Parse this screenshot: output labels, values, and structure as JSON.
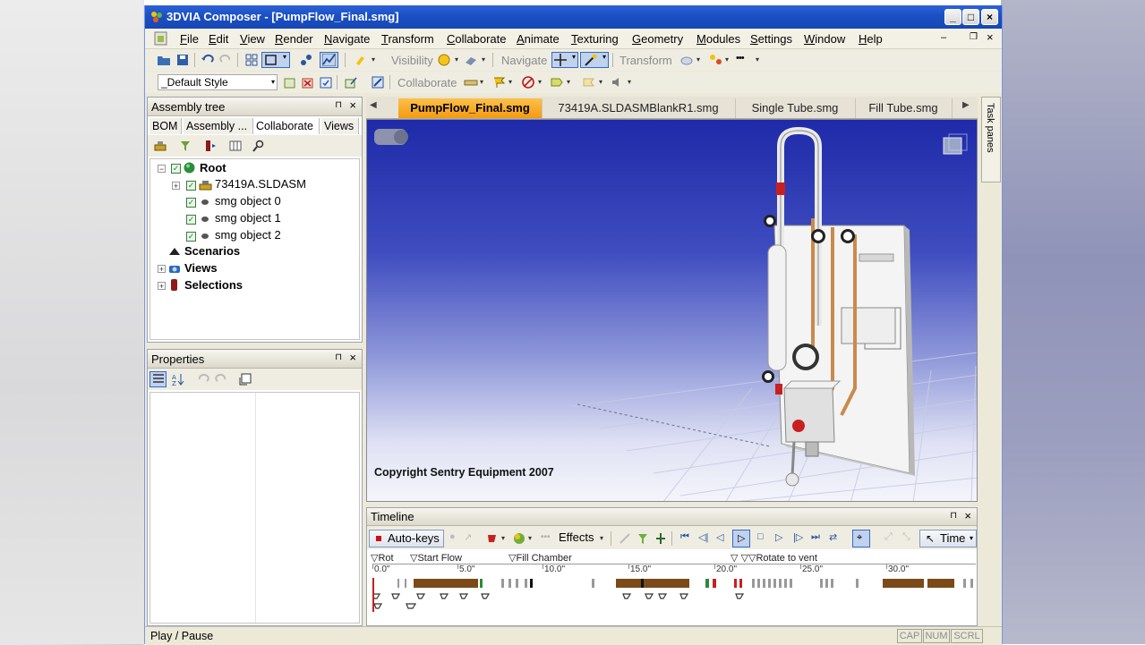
{
  "window": {
    "title": "3DVIA Composer - [PumpFlow_Final.smg]"
  },
  "menu": [
    "File",
    "Edit",
    "View",
    "Render",
    "Navigate",
    "Transform",
    "Collaborate",
    "Animate",
    "Texturing",
    "Geometry",
    "Modules",
    "Settings",
    "Window",
    "Help"
  ],
  "toolbar": {
    "visibility_label": "Visibility",
    "navigate_label": "Navigate",
    "transform_label": "Transform",
    "style_value": "_Default Style",
    "collaborate_label": "Collaborate"
  },
  "assembly_tree": {
    "title": "Assembly tree",
    "tabs": [
      "BOM",
      "Assembly ...",
      "Collaborate",
      "Views"
    ],
    "nodes": {
      "root": "Root",
      "asm": "73419A.SLDASM",
      "obj0": "smg object 0",
      "obj1": "smg object 1",
      "obj2": "smg object 2",
      "scenarios": "Scenarios",
      "views": "Views",
      "selections": "Selections"
    }
  },
  "properties": {
    "title": "Properties"
  },
  "document_tabs": [
    "PumpFlow_Final.smg",
    "73419A.SLDASMBlankR1.smg",
    "Single Tube.smg",
    "Fill Tube.smg"
  ],
  "viewport": {
    "copyright": "Copyright Sentry Equipment 2007"
  },
  "task_panes_label": "Task panes",
  "timeline": {
    "title": "Timeline",
    "autokeys_label": "Auto-keys",
    "effects_label": "Effects",
    "time_label": "Time",
    "markers": [
      "Rot",
      "Start Flow",
      "Fill Chamber",
      "Rotate to vent"
    ],
    "ticks": [
      "0.0\"",
      "5.0\"",
      "10.0\"",
      "15.0\"",
      "20.0\"",
      "25.0\"",
      "30.0\""
    ]
  },
  "status": {
    "text": "Play / Pause",
    "indicators": [
      "CAP",
      "NUM",
      "SCRL"
    ]
  }
}
